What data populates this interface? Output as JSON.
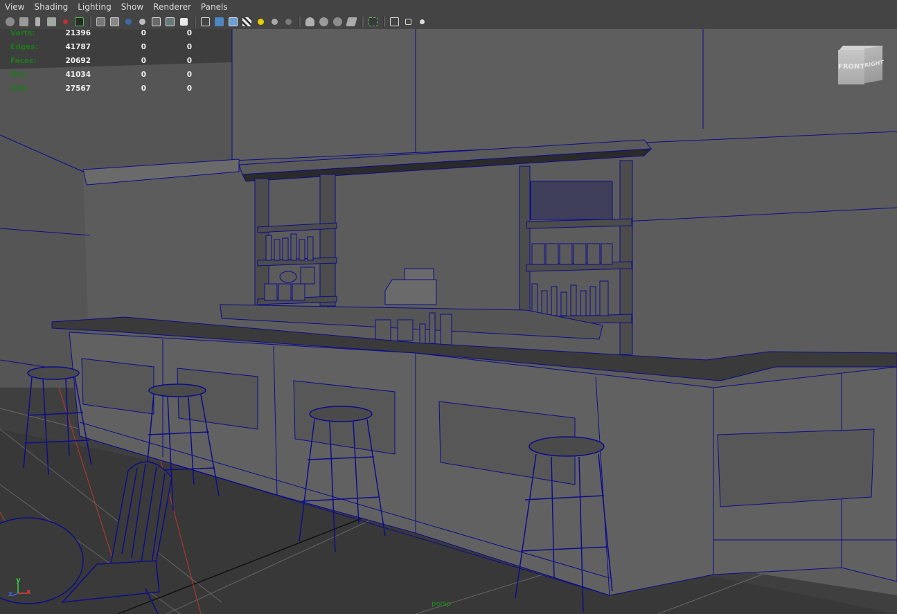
{
  "menu": {
    "items": [
      "View",
      "Shading",
      "Lighting",
      "Show",
      "Renderer",
      "Panels"
    ]
  },
  "toolbar": {
    "icons": [
      "select-camera-icon",
      "camera-attributes-icon",
      "bookmark-icon",
      "image-plane-icon",
      "camera-tools-icon",
      "grease-pencil-icon",
      "film-gate-icon",
      "resolution-gate-icon",
      "gate-mask-icon",
      "field-chart-icon",
      "safe-action-icon",
      "safe-title-icon",
      "wireframe-icon",
      "smooth-shade-icon",
      "wireframe-on-shaded-icon",
      "textured-icon",
      "use-lights-icon",
      "shadows-icon",
      "ambient-occlusion-icon",
      "motion-blur-icon",
      "anti-aliasing-icon",
      "depth-of-field-icon",
      "xray-icon",
      "xray-joints-icon",
      "isolate-select-icon",
      "xray-active-icon",
      "grid-icon"
    ]
  },
  "hud": {
    "rows": [
      {
        "label": "Verts:",
        "v1": "21396",
        "v2": "0",
        "v3": "0"
      },
      {
        "label": "Edges:",
        "v1": "41787",
        "v2": "0",
        "v3": "0"
      },
      {
        "label": "Faces:",
        "v1": "20692",
        "v2": "0",
        "v3": "0"
      },
      {
        "label": "Tris:",
        "v1": "41034",
        "v2": "0",
        "v3": "0"
      },
      {
        "label": "UVs:",
        "v1": "27567",
        "v2": "0",
        "v3": "0"
      }
    ]
  },
  "viewcube": {
    "front": "FRONT",
    "right": "RIGHT"
  },
  "axis": {
    "x": "x",
    "y": "y",
    "z": "z"
  },
  "camera": {
    "label": "persp"
  },
  "colors": {
    "wire": "#0c0c8c",
    "hud_label": "#1c7a1c",
    "hud_value": "#f0f0f0",
    "viewport_bg": "#5c5c5c"
  }
}
